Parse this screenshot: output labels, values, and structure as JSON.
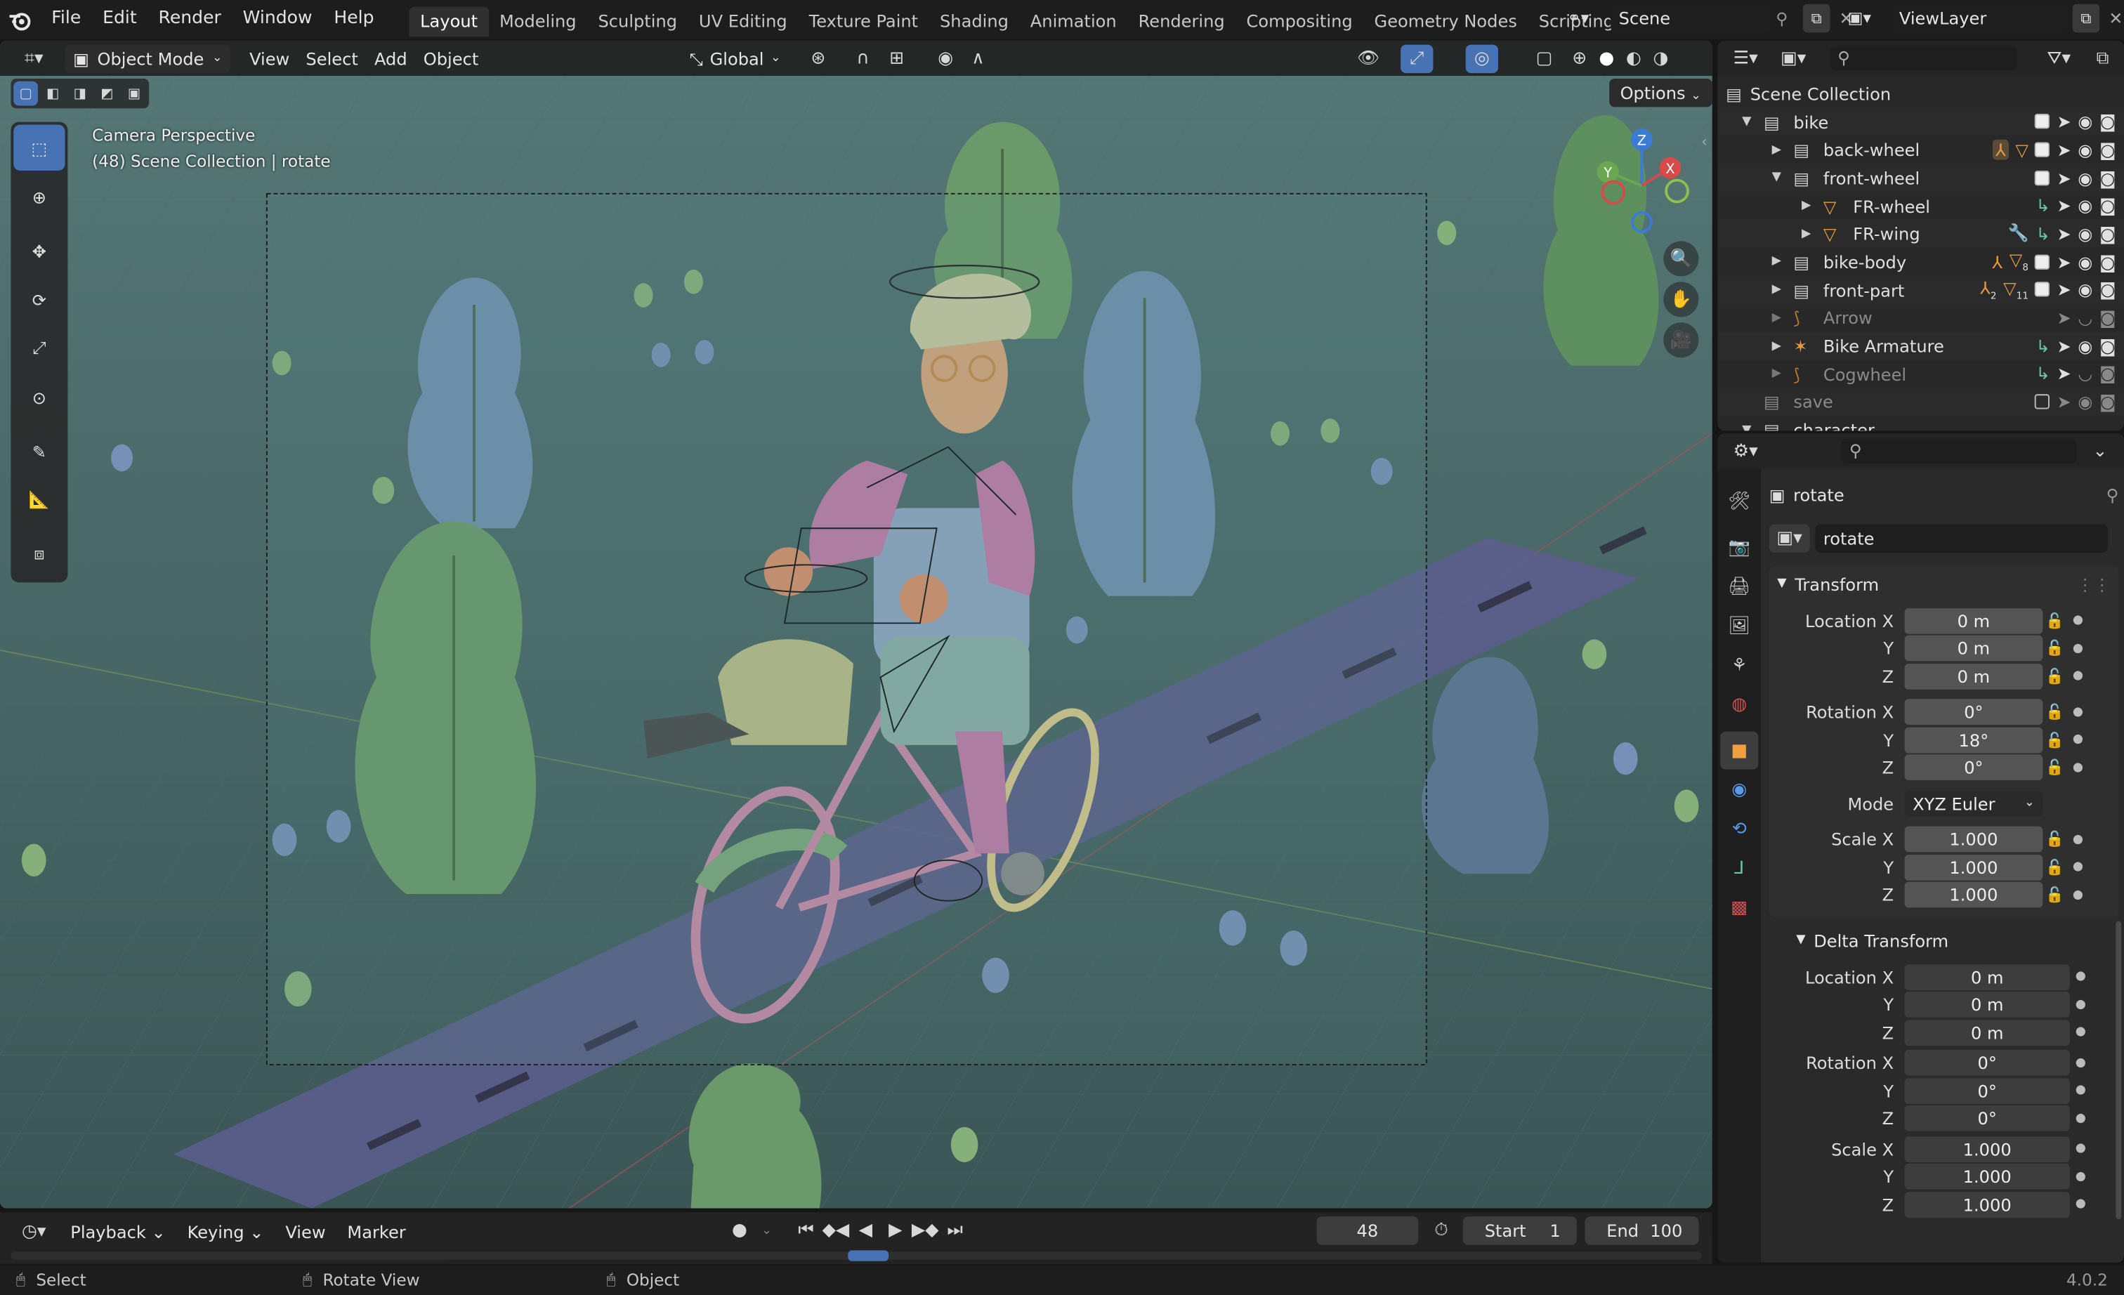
{
  "menus": [
    "File",
    "Edit",
    "Render",
    "Window",
    "Help"
  ],
  "workspaces": [
    "Layout",
    "Modeling",
    "Sculpting",
    "UV Editing",
    "Texture Paint",
    "Shading",
    "Animation",
    "Rendering",
    "Compositing",
    "Geometry Nodes",
    "Scripting"
  ],
  "active_workspace": "Layout",
  "scene_name": "Scene",
  "view_layer": "ViewLayer",
  "viewport": {
    "mode": "Object Mode",
    "header_menus": [
      "View",
      "Select",
      "Add",
      "Object"
    ],
    "transform_orientation": "Global",
    "options_label": "Options",
    "overlay_title": "Camera Perspective",
    "overlay_subtitle": "(48) Scene Collection | rotate",
    "gizmo_axes": [
      "Z",
      "Y",
      "X"
    ]
  },
  "outliner": {
    "rows": [
      {
        "label": "Scene Collection",
        "indent": 0
      },
      {
        "label": "bike",
        "indent": 1
      },
      {
        "label": "back-wheel",
        "indent": 2
      },
      {
        "label": "front-wheel",
        "indent": 2
      },
      {
        "label": "FR-wheel",
        "indent": 3
      },
      {
        "label": "FR-wing",
        "indent": 3
      },
      {
        "label": "bike-body",
        "indent": 2
      },
      {
        "label": "front-part",
        "indent": 2
      },
      {
        "label": "Arrow",
        "indent": 2
      },
      {
        "label": "Bike Armature",
        "indent": 2
      },
      {
        "label": "Cogwheel",
        "indent": 2
      },
      {
        "label": "save",
        "indent": 1
      },
      {
        "label": "character",
        "indent": 1
      }
    ],
    "badges": {
      "bike_body": "8",
      "front_part_a": "2",
      "front_part_b": "11"
    }
  },
  "properties": {
    "object_name": "rotate",
    "data_name": "rotate",
    "transform_title": "Transform",
    "delta_title": "Delta Transform",
    "labels": {
      "location_x": "Location X",
      "rotation_x": "Rotation X",
      "scale_x": "Scale X",
      "y": "Y",
      "z": "Z",
      "mode": "Mode"
    },
    "location": [
      "0 m",
      "0 m",
      "0 m"
    ],
    "rotation": [
      "0°",
      "18°",
      "0°"
    ],
    "rotation_mode": "XYZ Euler",
    "scale": [
      "1.000",
      "1.000",
      "1.000"
    ],
    "delta_location": [
      "0 m",
      "0 m",
      "0 m"
    ],
    "delta_rotation": [
      "0°",
      "0°",
      "0°"
    ],
    "delta_scale": [
      "1.000",
      "1.000",
      "1.000"
    ]
  },
  "timeline": {
    "menus": [
      "Playback",
      "Keying",
      "View",
      "Marker"
    ],
    "current_frame": "48",
    "start_label": "Start",
    "start": "1",
    "end_label": "End",
    "end": "100"
  },
  "statusbar": {
    "select": "Select",
    "rotate_view": "Rotate View",
    "object": "Object",
    "version": "4.0.2"
  }
}
